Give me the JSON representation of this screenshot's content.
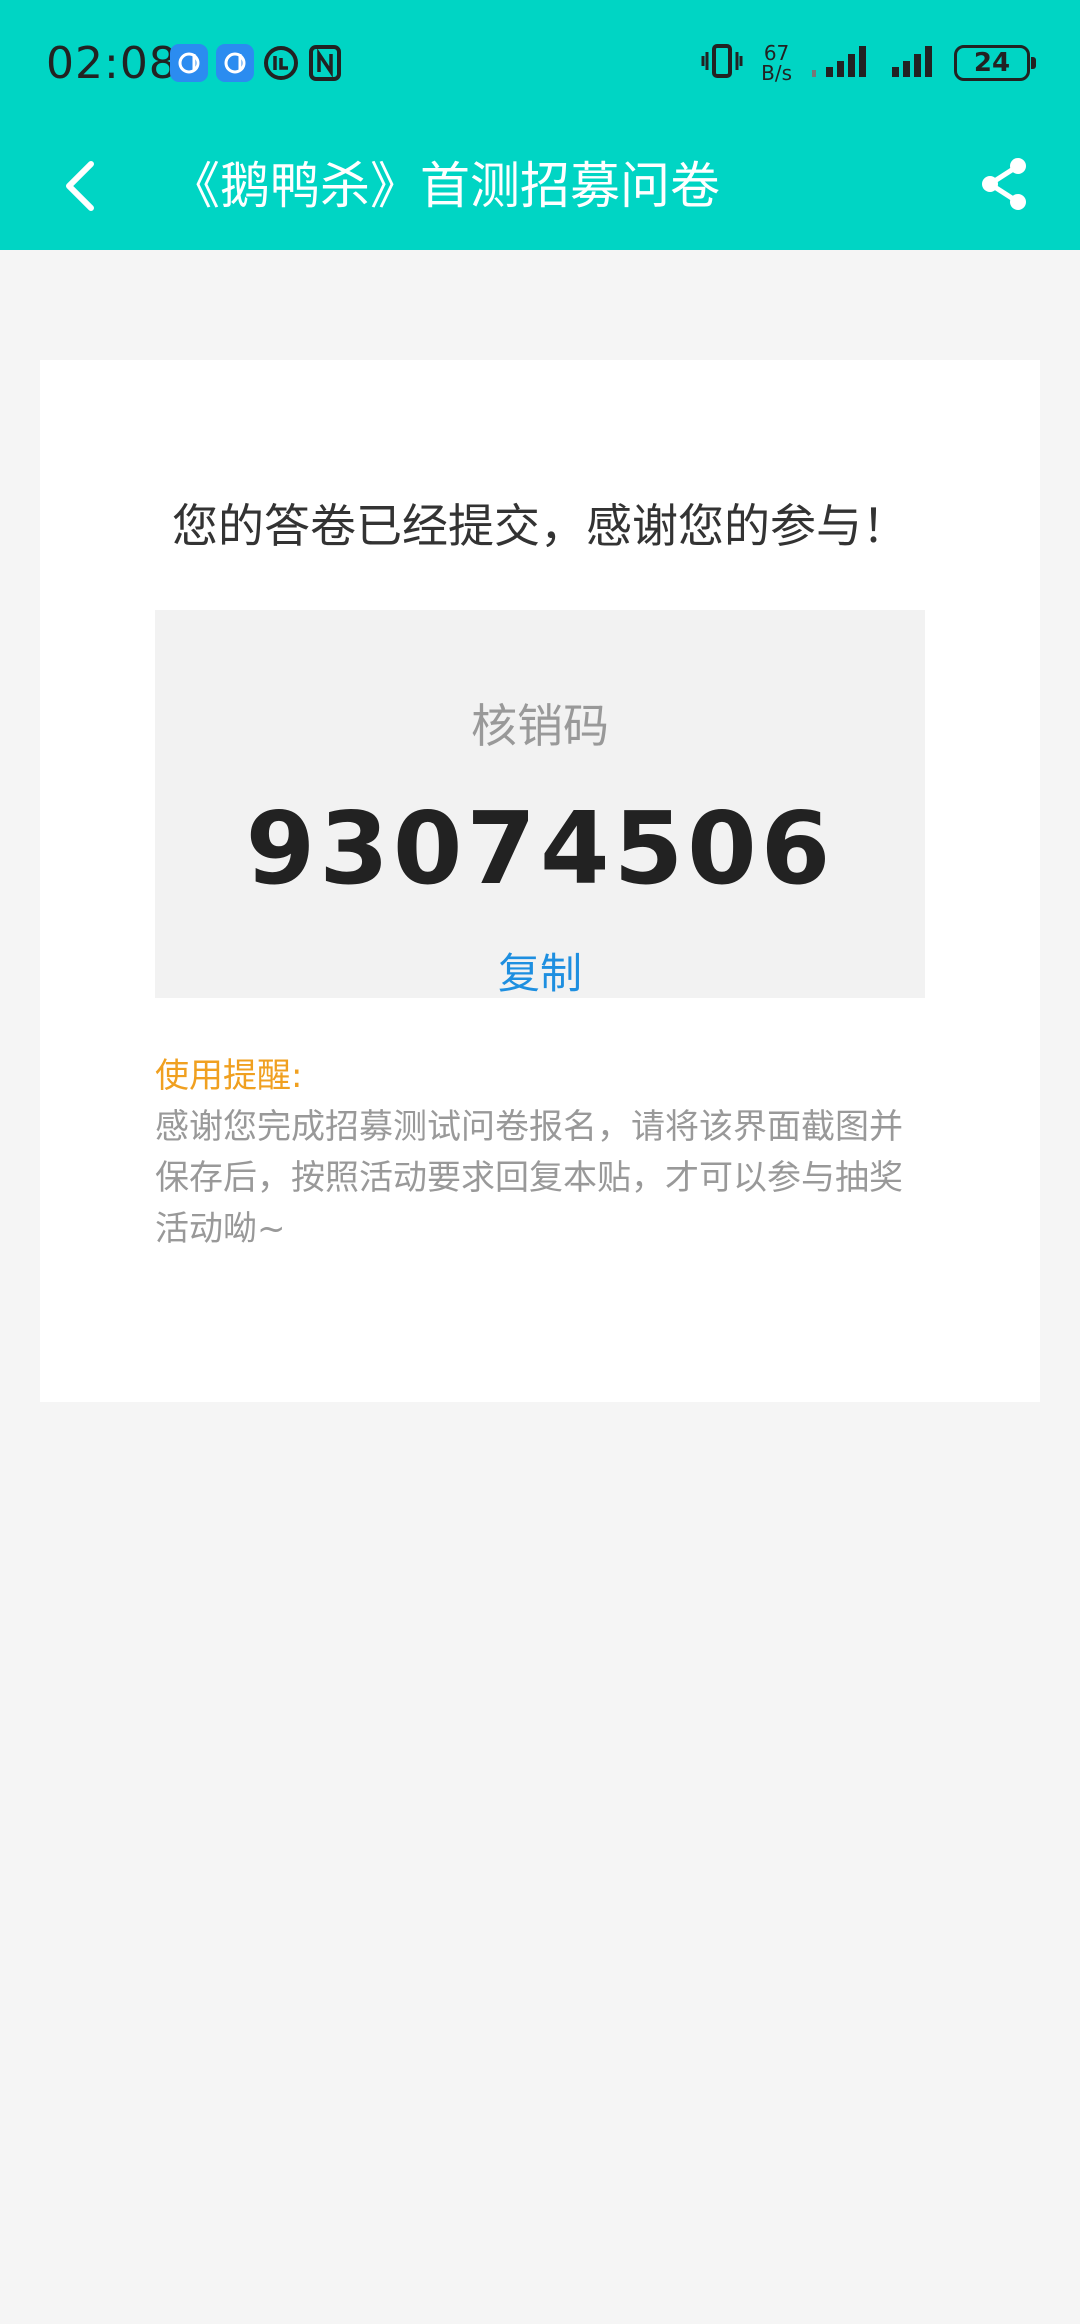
{
  "status_bar": {
    "time": "02:08",
    "net_speed_value": "67",
    "net_speed_unit": "B/s",
    "battery": "24"
  },
  "nav": {
    "title": "《鹅鸭杀》首测招募问卷"
  },
  "content": {
    "success_message": "您的答卷已经提交，感谢您的参与！",
    "code_label": "核销码",
    "code_value": "93074506",
    "copy_label": "复制",
    "reminder_title": "使用提醒:",
    "reminder_text": "感谢您完成招募测试问卷报名，请将该界面截图并保存后，按照活动要求回复本贴，才可以参与抽奖活动呦~"
  },
  "colors": {
    "header_bg": "#00d5c4",
    "accent_link": "#1e8fe0",
    "reminder_title": "#f0a020"
  }
}
